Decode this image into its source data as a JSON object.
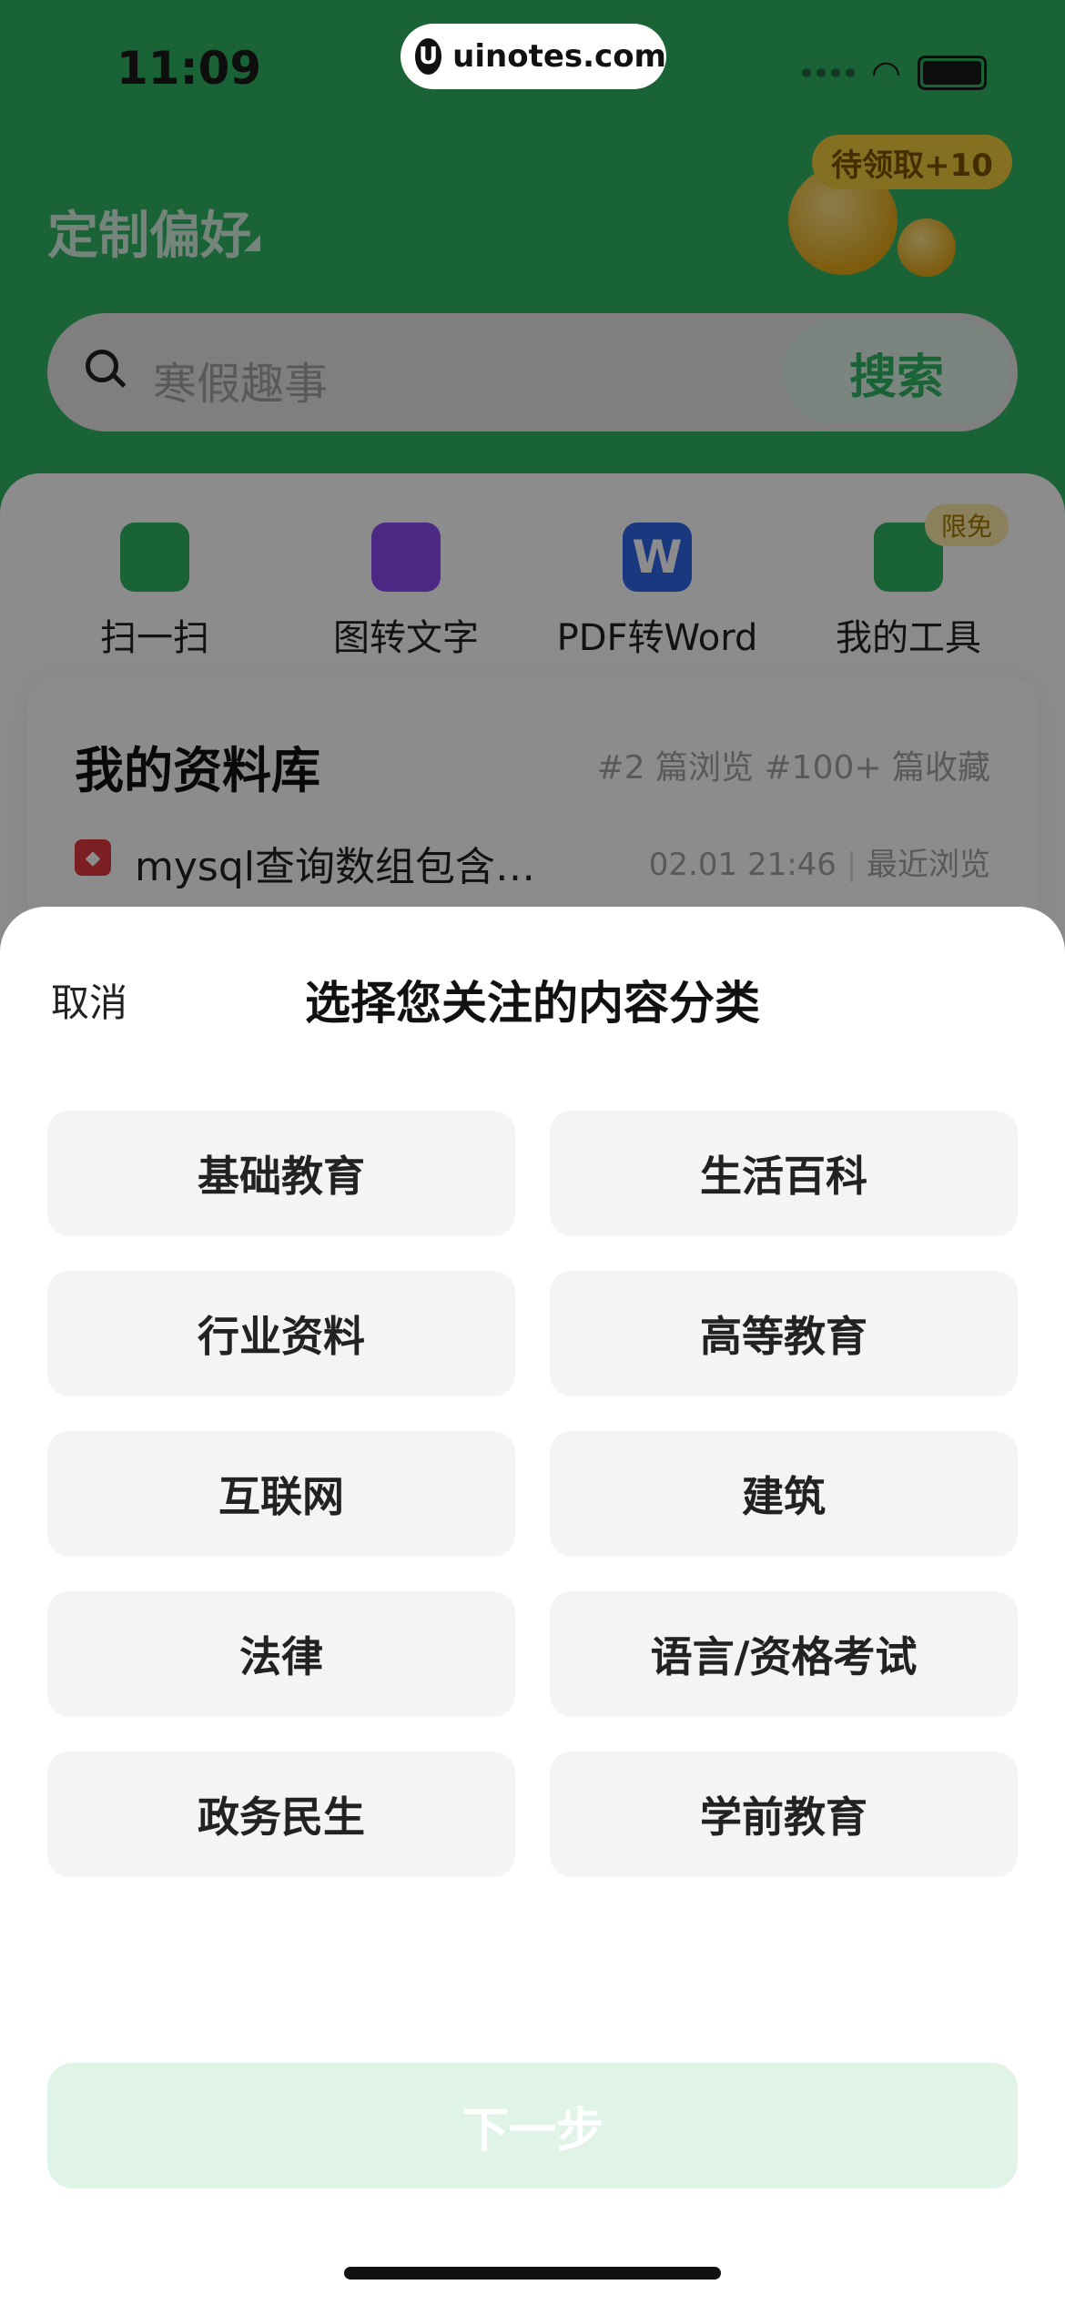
{
  "status_bar": {
    "time": "11:09"
  },
  "watermark": {
    "text": "uinotes.com",
    "logo_glyph": "U"
  },
  "header": {
    "preference_title": "定制偏好",
    "reward_badge": "待领取+10"
  },
  "search": {
    "placeholder": "寒假趣事",
    "button_label": "搜索"
  },
  "tools": [
    {
      "label": "扫一扫",
      "icon": "scan-icon"
    },
    {
      "label": "图转文字",
      "icon": "image-to-text-icon"
    },
    {
      "label": "PDF转Word",
      "icon": "pdf-to-word-icon",
      "glyph": "W"
    },
    {
      "label": "我的工具",
      "icon": "toolbox-icon",
      "badge": "限免"
    }
  ],
  "library": {
    "title": "我的资料库",
    "stats": "#2 篇浏览 #100+ 篇收藏",
    "recent": {
      "doc_title": "mysql查询数组包含…",
      "time": "02.01  21:46",
      "tag": "最近浏览"
    }
  },
  "sheet": {
    "cancel_label": "取消",
    "title": "选择您关注的内容分类",
    "categories": [
      "基础教育",
      "生活百科",
      "行业资料",
      "高等教育",
      "互联网",
      "建筑",
      "法律",
      "语言/资格考试",
      "政务民生",
      "学前教育"
    ],
    "next_label": "下一步"
  },
  "colors": {
    "brand_green": "#2fb463",
    "next_disabled_bg": "#dff3e6",
    "category_bg": "#f4f4f4"
  }
}
